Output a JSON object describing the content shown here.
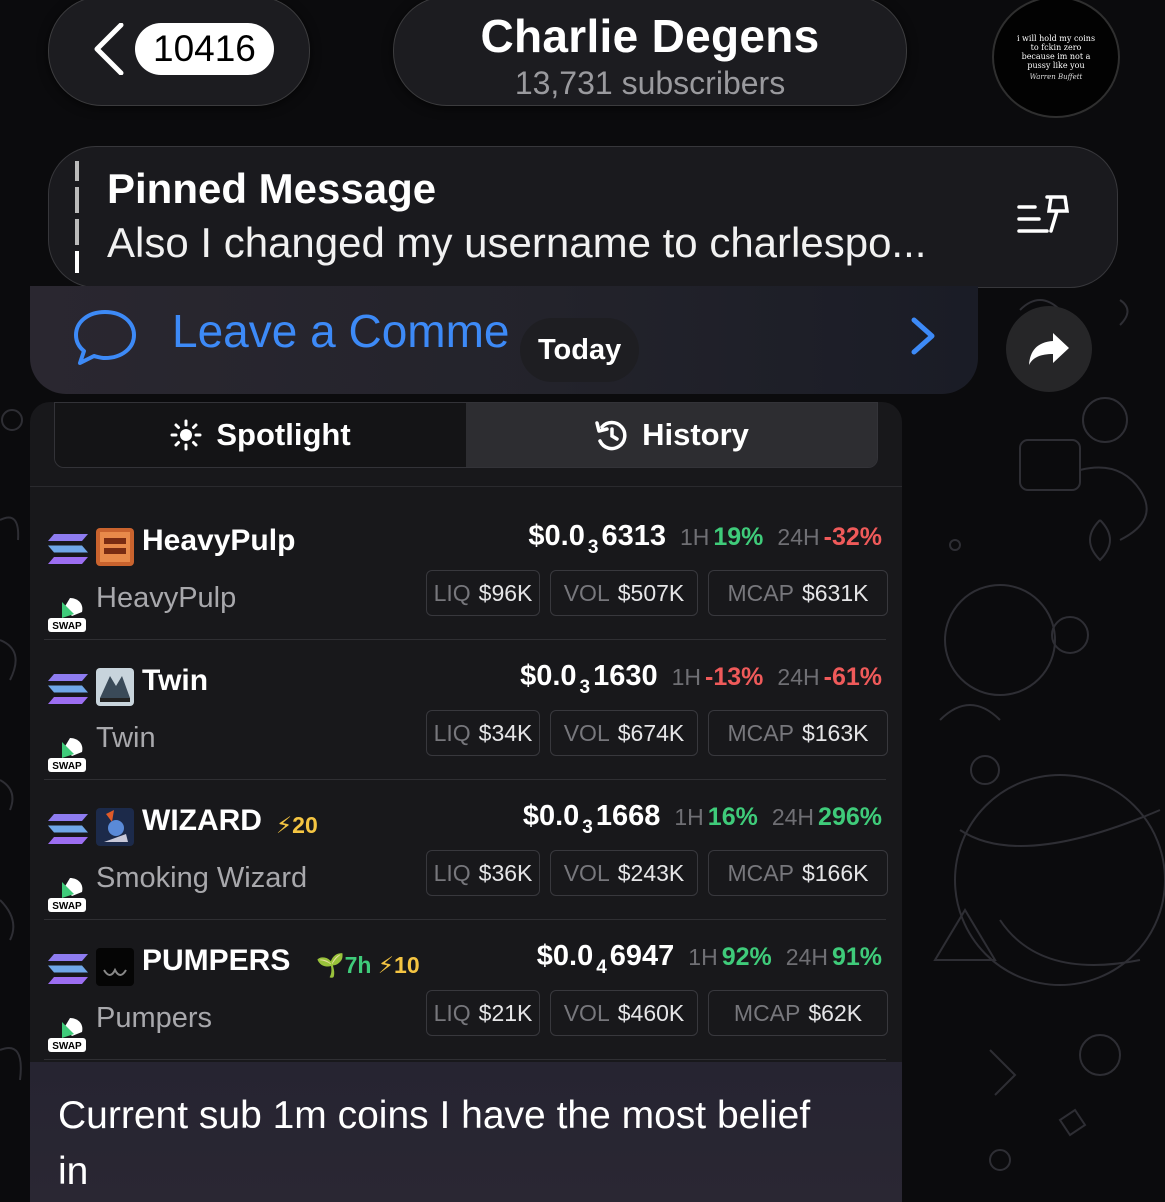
{
  "header": {
    "unread_count": "10416",
    "channel_title": "Charlie Degens",
    "subscribers": "13,731 subscribers",
    "avatar_quote": "i will hold my coins to fckin zero because im not a pussy like you",
    "avatar_attribution": "Warren Buffett"
  },
  "pinned": {
    "title": "Pinned Message",
    "text": "Also I changed my username to charlespo..."
  },
  "comments": {
    "label": "Leave a Comme"
  },
  "date_separator": "Today",
  "widget": {
    "tabs": [
      {
        "label": "Spotlight",
        "active": true
      },
      {
        "label": "History",
        "active": false
      }
    ],
    "tokens": [
      {
        "symbol": "HeavyPulp",
        "name": "HeavyPulp",
        "badges": "",
        "price_prefix": "$0.0",
        "price_zeros": "3",
        "price_digits": "6313",
        "h1_label": "1H",
        "h1": "19%",
        "h1_dir": "up",
        "h24_label": "24H",
        "h24": "-32%",
        "h24_dir": "down",
        "liq_label": "LIQ",
        "liq": "$96K",
        "vol_label": "VOL",
        "vol": "$507K",
        "mcap_label": "MCAP",
        "mcap": "$631K"
      },
      {
        "symbol": "Twin",
        "name": "Twin",
        "badges": "",
        "price_prefix": "$0.0",
        "price_zeros": "3",
        "price_digits": "1630",
        "h1_label": "1H",
        "h1": "-13%",
        "h1_dir": "down",
        "h24_label": "24H",
        "h24": "-61%",
        "h24_dir": "down",
        "liq_label": "LIQ",
        "liq": "$34K",
        "vol_label": "VOL",
        "vol": "$674K",
        "mcap_label": "MCAP",
        "mcap": "$163K"
      },
      {
        "symbol": "WIZARD",
        "name": "Smoking Wizard",
        "boost": "20",
        "age": "",
        "price_prefix": "$0.0",
        "price_zeros": "3",
        "price_digits": "1668",
        "h1_label": "1H",
        "h1": "16%",
        "h1_dir": "up",
        "h24_label": "24H",
        "h24": "296%",
        "h24_dir": "up",
        "liq_label": "LIQ",
        "liq": "$36K",
        "vol_label": "VOL",
        "vol": "$243K",
        "mcap_label": "MCAP",
        "mcap": "$166K"
      },
      {
        "symbol": "PUMPERS",
        "name": "Pumpers",
        "boost": "10",
        "age": "7h",
        "price_prefix": "$0.0",
        "price_zeros": "4",
        "price_digits": "6947",
        "h1_label": "1H",
        "h1": "92%",
        "h1_dir": "up",
        "h24_label": "24H",
        "h24": "91%",
        "h24_dir": "up",
        "liq_label": "LIQ",
        "liq": "$21K",
        "vol_label": "VOL",
        "vol": "$460K",
        "mcap_label": "MCAP",
        "mcap": "$62K"
      }
    ],
    "swap_label": "SWAP"
  },
  "message": {
    "text": "Current sub 1m coins I have the most belief in"
  },
  "colors": {
    "accent_blue": "#3d8af7",
    "positive": "#3fcb7a",
    "negative": "#ef5a5a",
    "boost": "#f5c542"
  }
}
